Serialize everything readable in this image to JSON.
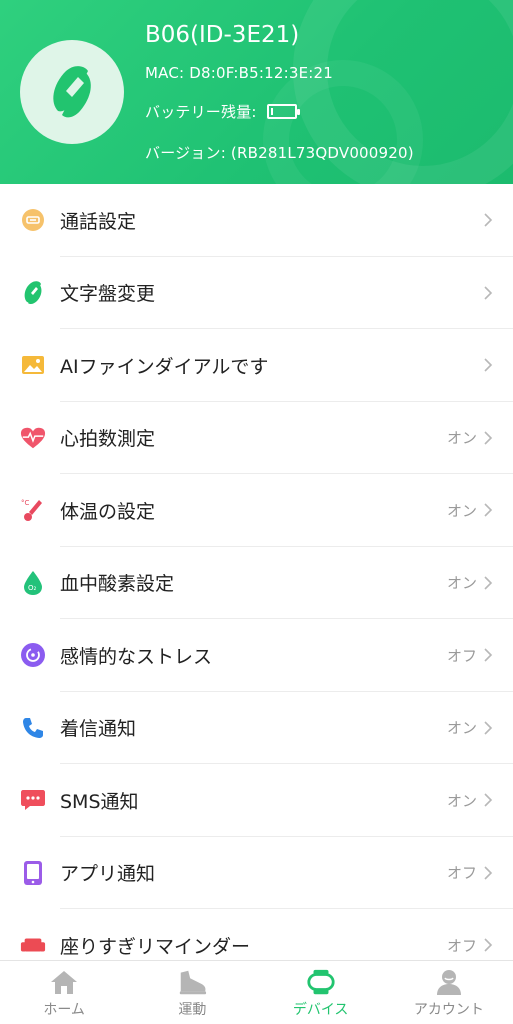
{
  "device": {
    "name": "B06(ID-3E21)",
    "mac": "MAC:  D8:0F:B5:12:3E:21",
    "battery_label": "バッテリー残量:",
    "battery_level": 0.1,
    "version": "バージョン:  (RB281L73QDV000920)"
  },
  "settings": [
    {
      "label": "通話設定",
      "status": "",
      "icon": "call-settings-icon"
    },
    {
      "label": "文字盤変更",
      "status": "",
      "icon": "watch-face-icon"
    },
    {
      "label": "AIファインダイアルです",
      "status": "",
      "icon": "image-icon"
    },
    {
      "label": "心拍数測定",
      "status": "オン",
      "icon": "heart-rate-icon"
    },
    {
      "label": "体温の設定",
      "status": "オン",
      "icon": "thermometer-icon"
    },
    {
      "label": "血中酸素設定",
      "status": "オン",
      "icon": "blood-oxygen-icon"
    },
    {
      "label": "感情的なストレス",
      "status": "オフ",
      "icon": "stress-icon"
    },
    {
      "label": "着信通知",
      "status": "オン",
      "icon": "phone-icon"
    },
    {
      "label": "SMS通知",
      "status": "オン",
      "icon": "sms-icon"
    },
    {
      "label": "アプリ通知",
      "status": "オフ",
      "icon": "app-icon"
    },
    {
      "label": "座りすぎリマインダー",
      "status": "オフ",
      "icon": "sofa-icon"
    }
  ],
  "tabs": [
    {
      "label": "ホーム",
      "icon": "home-icon",
      "active": false
    },
    {
      "label": "運動",
      "icon": "shoe-icon",
      "active": false
    },
    {
      "label": "デバイス",
      "icon": "watch-icon",
      "active": true
    },
    {
      "label": "アカウント",
      "icon": "account-icon",
      "active": false
    }
  ],
  "colors": {
    "accent": "#22c46f",
    "header": "#1fc173"
  }
}
